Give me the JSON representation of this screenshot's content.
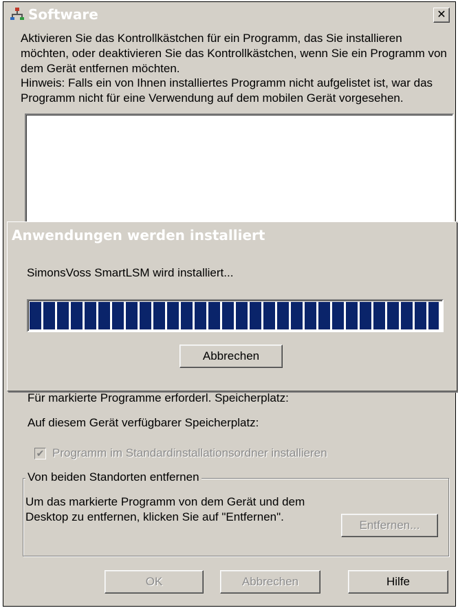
{
  "window": {
    "title": "Software",
    "close_glyph": "✕",
    "icon": "software-install-icon"
  },
  "instructions": "Aktivieren Sie das Kontrollkästchen für ein Programm, das Sie installieren möchten, oder deaktivieren Sie das Kontrollkästchen, wenn Sie ein Programm von dem Gerät entfernen möchten.",
  "hint": "Hinweis: Falls ein von Ihnen installiertes Programm nicht aufgelistet ist, war das Programm nicht für eine Verwendung auf dem mobilen Gerät vorgesehen.",
  "program_list": [],
  "space_required_label": "Für markierte Programme erforderl. Speicherplatz:",
  "space_available_label": "Auf diesem Gerät verfügbarer Speicherplatz:",
  "default_folder_checkbox": {
    "label": "Programm im Standardinstallationsordner installieren",
    "checked": true,
    "enabled": false
  },
  "remove_group": {
    "title": "Von beiden Standorten entfernen",
    "text": "Um das markierte Programm von dem Gerät und dem Desktop zu entfernen, klicken Sie auf \"Entfernen\".",
    "remove_button": "Entfernen..."
  },
  "buttons": {
    "ok": "OK",
    "cancel": "Abbrechen",
    "help": "Hilfe"
  },
  "progress_dialog": {
    "title": "Anwendungen werden installiert",
    "status": "SimonsVoss SmartLSM wird installiert...",
    "progress": 0.995,
    "cancel_button": "Abbrechen"
  },
  "colors": {
    "dialog_face": "#d4d0c8",
    "progress_fill": "#0a246a",
    "disabled_text": "#8c8c8c"
  }
}
